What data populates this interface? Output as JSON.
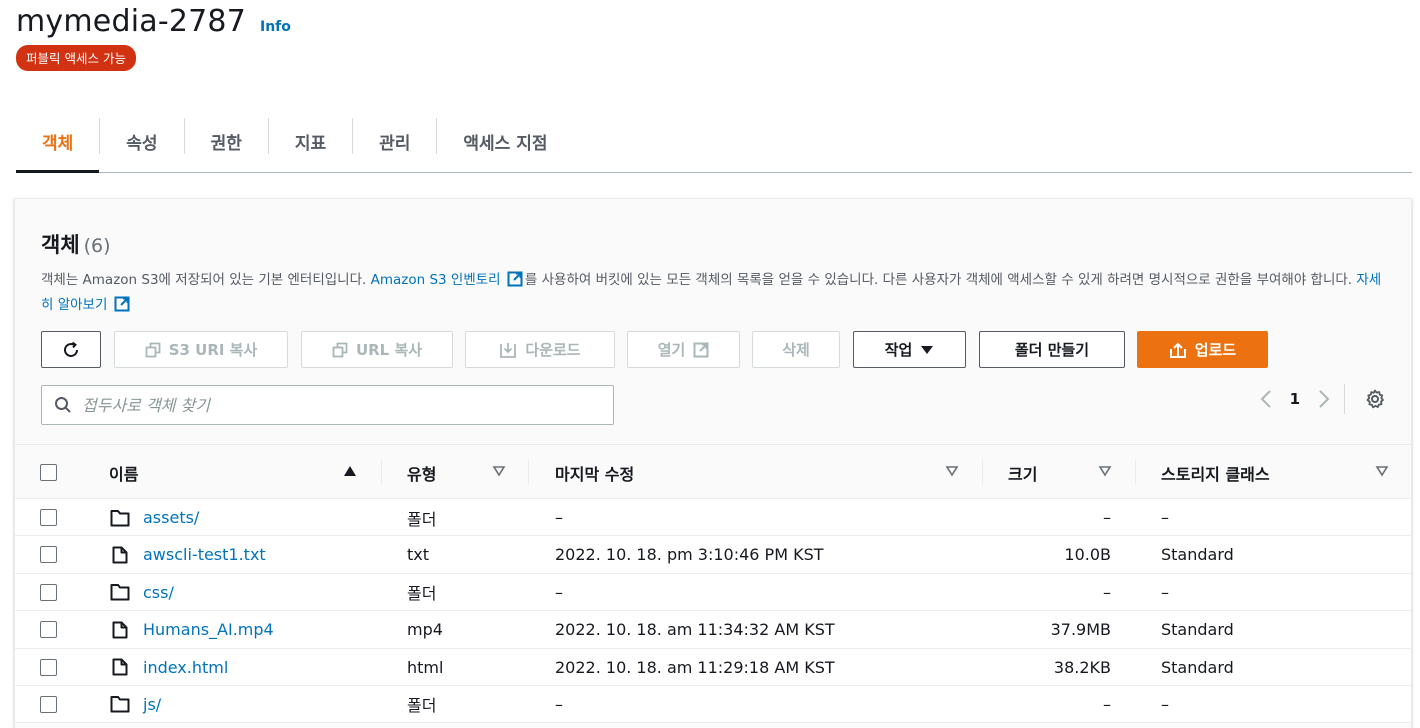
{
  "header": {
    "bucket_name": "mymedia-2787",
    "info_label": "Info",
    "badge": "퍼블릭 액세스 가능"
  },
  "tabs": [
    {
      "label": "객체",
      "active": true
    },
    {
      "label": "속성",
      "active": false
    },
    {
      "label": "권한",
      "active": false
    },
    {
      "label": "지표",
      "active": false
    },
    {
      "label": "관리",
      "active": false
    },
    {
      "label": "액세스 지점",
      "active": false
    }
  ],
  "panel": {
    "title": "객체",
    "count": "(6)",
    "desc_part1": "객체는 Amazon S3에 저장되어 있는 기본 엔터티입니다.",
    "desc_link1": "Amazon S3 인벤토리",
    "desc_part2": "를 사용하여 버킷에 있는 모든 객체의 목록을 얻을 수 있습니다. 다른 사용자가 객체에 액세스할 수 있게 하려면 명시적으로 권한을 부여해야 합니다.",
    "desc_link2": "자세히 알아보기"
  },
  "toolbar": {
    "refresh_icon": "refresh-icon",
    "copy_s3_uri": "S3 URI 복사",
    "copy_url": "URL 복사",
    "download": "다운로드",
    "open": "열기",
    "delete": "삭제",
    "actions": "작업",
    "create_folder": "폴더 만들기",
    "upload": "업로드"
  },
  "search": {
    "placeholder": "접두사로 객체 찾기",
    "value": ""
  },
  "pagination": {
    "page": "1"
  },
  "colors": {
    "accent": "#ec7211",
    "link": "#0073bb",
    "badge": "#d13212"
  },
  "table": {
    "columns": [
      "이름",
      "유형",
      "마지막 수정",
      "크기",
      "스토리지 클래스"
    ],
    "rows": [
      {
        "name": "assets/",
        "icon": "folder-icon",
        "type": "폴더",
        "modified": "–",
        "size": "–",
        "storage": "–"
      },
      {
        "name": "awscli-test1.txt",
        "icon": "file-icon",
        "type": "txt",
        "modified": "2022. 10. 18. pm 3:10:46 PM KST",
        "size": "10.0B",
        "storage": "Standard"
      },
      {
        "name": "css/",
        "icon": "folder-icon",
        "type": "폴더",
        "modified": "–",
        "size": "–",
        "storage": "–"
      },
      {
        "name": "Humans_AI.mp4",
        "icon": "file-icon",
        "type": "mp4",
        "modified": "2022. 10. 18. am 11:34:32 AM KST",
        "size": "37.9MB",
        "storage": "Standard"
      },
      {
        "name": "index.html",
        "icon": "file-icon",
        "type": "html",
        "modified": "2022. 10. 18. am 11:29:18 AM KST",
        "size": "38.2KB",
        "storage": "Standard"
      },
      {
        "name": "js/",
        "icon": "folder-icon",
        "type": "폴더",
        "modified": "–",
        "size": "–",
        "storage": "–"
      }
    ]
  }
}
